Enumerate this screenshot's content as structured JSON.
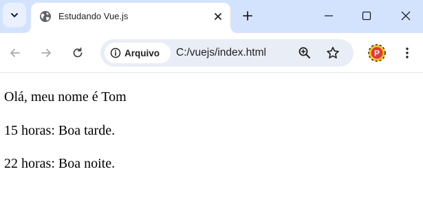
{
  "browser": {
    "tab": {
      "title": "Estudando Vue.js",
      "favicon": "globe-icon"
    },
    "tab_search_icon": "chevron-down-icon",
    "new_tab_icon": "plus-icon",
    "window_controls": [
      "minimize-icon",
      "maximize-icon",
      "close-icon"
    ],
    "toolbar": {
      "icons": [
        "back-arrow-icon",
        "forward-arrow-icon",
        "reload-icon"
      ],
      "site_info_label": "Arquivo",
      "url": "C:/vuejs/index.html",
      "zoom_icon": "zoom-in-icon",
      "bookmark_icon": "star-icon",
      "extension_icon": "extension-p-icon",
      "extension_letter": "P",
      "menu_icon": "kebab-menu-icon"
    },
    "accent_colors": {
      "tabstrip": "#d3e3fd",
      "omnibox": "#e9eef6",
      "extension_red": "#e53935",
      "extension_yellow": "#f9c623"
    }
  },
  "page": {
    "lines": [
      "Olá, meu nome é Tom",
      "15 horas: Boa tarde.",
      "22 horas: Boa noite."
    ]
  }
}
